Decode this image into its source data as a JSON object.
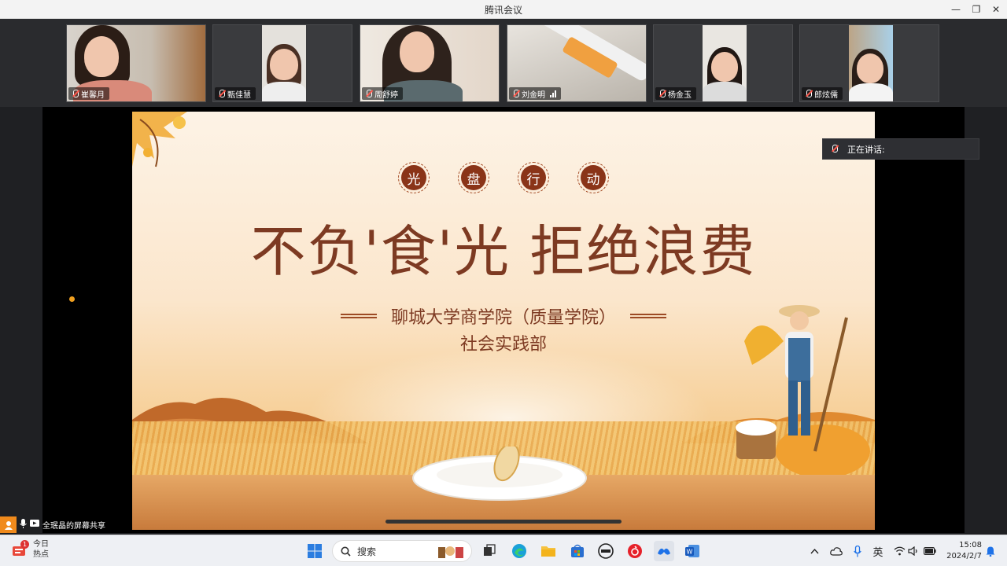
{
  "window": {
    "title": "腾讯会议",
    "min": "—",
    "restore": "❐",
    "close": "✕"
  },
  "participants": [
    {
      "name": "崔馨月",
      "signal": false
    },
    {
      "name": "甄佳慧",
      "signal": false
    },
    {
      "name": "周舒婷",
      "signal": false
    },
    {
      "name": "刘金明",
      "signal": true
    },
    {
      "name": "杨金玉",
      "signal": false
    },
    {
      "name": "郎炫儒",
      "signal": false
    }
  ],
  "slide": {
    "badges": [
      "光",
      "盘",
      "行",
      "动"
    ],
    "title": "不负'食'光 拒绝浪费",
    "org": "聊城大学商学院（质量学院）",
    "dept": "社会实践部"
  },
  "speaking": {
    "label": "正在讲话:"
  },
  "share": {
    "label": "全珉晶的屏幕共享"
  },
  "taskbar": {
    "weather_badge": "1",
    "weather_line1": "今日",
    "weather_line2": "热点",
    "search_placeholder": "搜索",
    "ime": "英",
    "time": "15:08",
    "date": "2024/2/7"
  },
  "colors": {
    "accent": "#8a3418",
    "title_text": "#7d3a22",
    "speaking_bg": "#2e2f33",
    "share_orange": "#f08a1c"
  }
}
